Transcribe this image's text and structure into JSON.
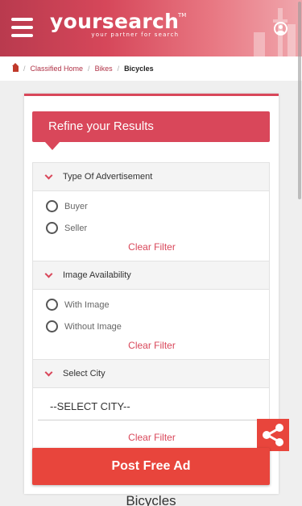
{
  "header": {
    "logo_word": "yoursearch",
    "logo_tm": "TM",
    "logo_tagline": "your partner for search"
  },
  "breadcrumb": {
    "items": [
      "Classified Home",
      "Bikes"
    ],
    "current": "Bicycles",
    "separator": "/"
  },
  "filters": {
    "title": "Refine your Results",
    "type_of_ad": {
      "label": "Type Of Advertisement",
      "options": [
        "Buyer",
        "Seller"
      ],
      "clear": "Clear Filter"
    },
    "image_availability": {
      "label": "Image Availability",
      "options": [
        "With Image",
        "Without Image"
      ],
      "clear": "Clear Filter"
    },
    "city": {
      "label": "Select City",
      "selected": "--SELECT CITY--",
      "clear": "Clear Filter"
    }
  },
  "actions": {
    "post_free_ad": "Post Free Ad"
  },
  "page_title": "Bicycles",
  "colors": {
    "brand": "#d9475a",
    "cta": "#e8453c"
  },
  "icons": {
    "menu": "hamburger-menu-icon",
    "user": "user-circle-icon",
    "home": "home-icon",
    "share": "share-icon",
    "chevron": "chevron-down-icon"
  }
}
